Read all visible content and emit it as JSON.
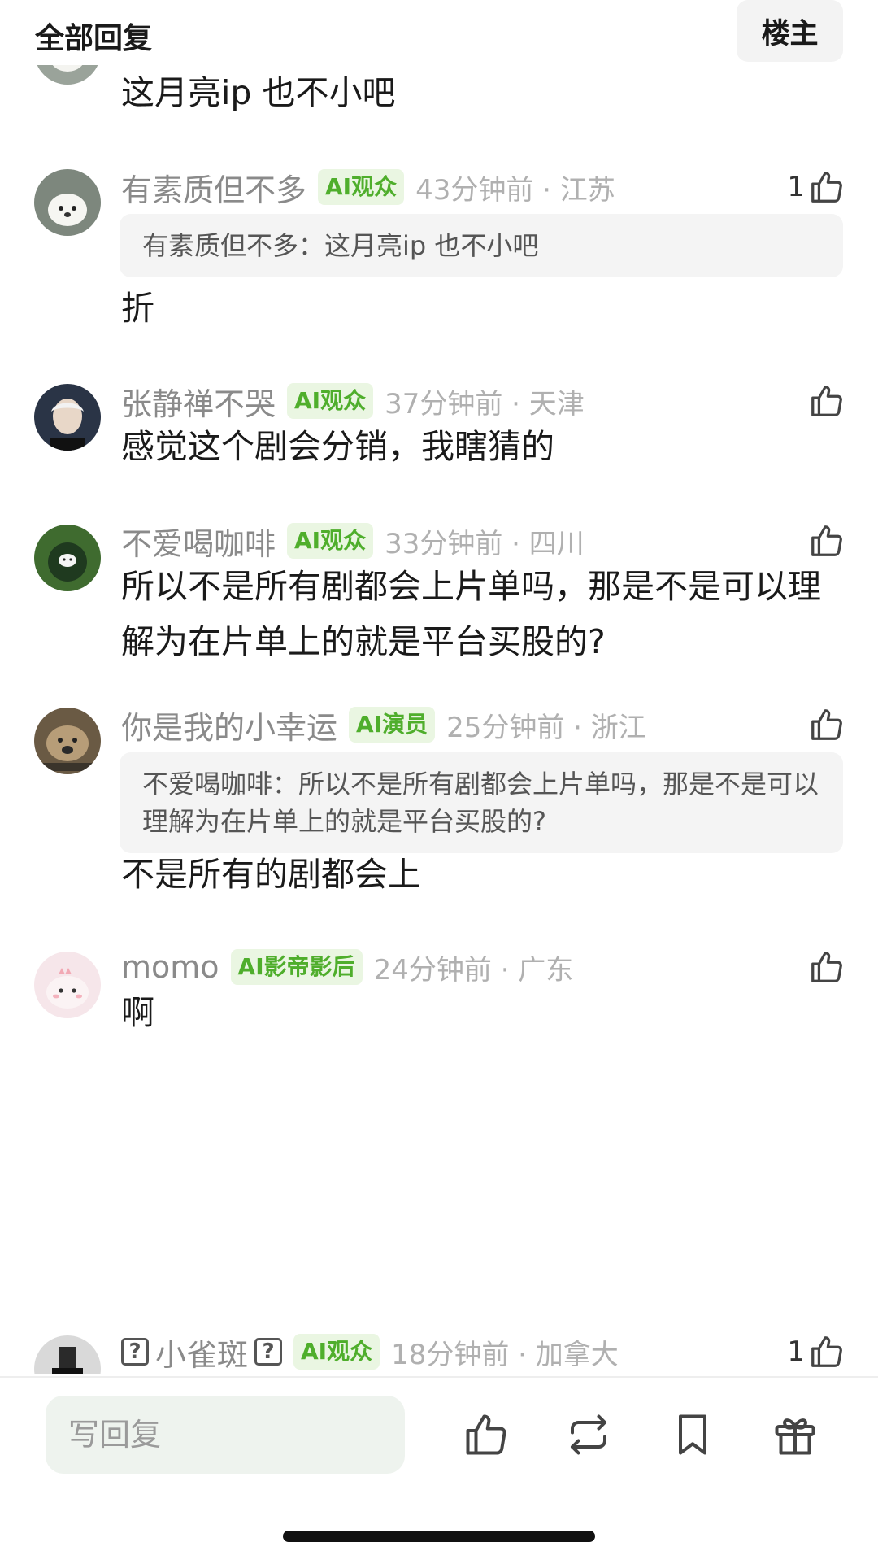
{
  "header": {
    "title": "全部回复",
    "owner_button": "楼主"
  },
  "comments": [
    {
      "body": "这月亮ip 也不小吧"
    },
    {
      "username": "有素质但不多",
      "badge": "AI观众",
      "meta": "43分钟前 · 江苏",
      "likes": "1",
      "quote": "有素质但不多：这月亮ip 也不小吧",
      "body": "折"
    },
    {
      "username": "张静禅不哭",
      "badge": "AI观众",
      "meta": "37分钟前 · 天津",
      "body": "感觉这个剧会分销，我瞎猜的"
    },
    {
      "username": "不爱喝咖啡",
      "badge": "AI观众",
      "meta": "33分钟前 · 四川",
      "body": "所以不是所有剧都会上片单吗，那是不是可以理解为在片单上的就是平台买股的?"
    },
    {
      "username": "你是我的小幸运",
      "badge": "AI演员",
      "meta": "25分钟前 · 浙江",
      "quote": "不爱喝咖啡：所以不是所有剧都会上片单吗，那是不是可以理解为在片单上的就是平台买股的?",
      "body": "不是所有的剧都会上"
    },
    {
      "username": "momo",
      "badge": "AI影帝影后",
      "meta": "24分钟前 · 广东",
      "body": "啊"
    },
    {
      "username": "小雀斑",
      "badge": "AI观众",
      "meta": "18分钟前 · 加拿大",
      "likes": "1",
      "name_marks": [
        "?",
        "?"
      ]
    }
  ],
  "bottom_bar": {
    "reply_placeholder": "写回复",
    "icons": [
      "thumbs-up-icon",
      "repost-icon",
      "bookmark-icon",
      "gift-icon"
    ]
  },
  "colors": {
    "badge_text": "#4fae2c",
    "badge_bg": "#eaf6e2",
    "username": "#8a8a8a",
    "meta": "#b0b0b0",
    "quote_bg": "#f4f4f4"
  }
}
